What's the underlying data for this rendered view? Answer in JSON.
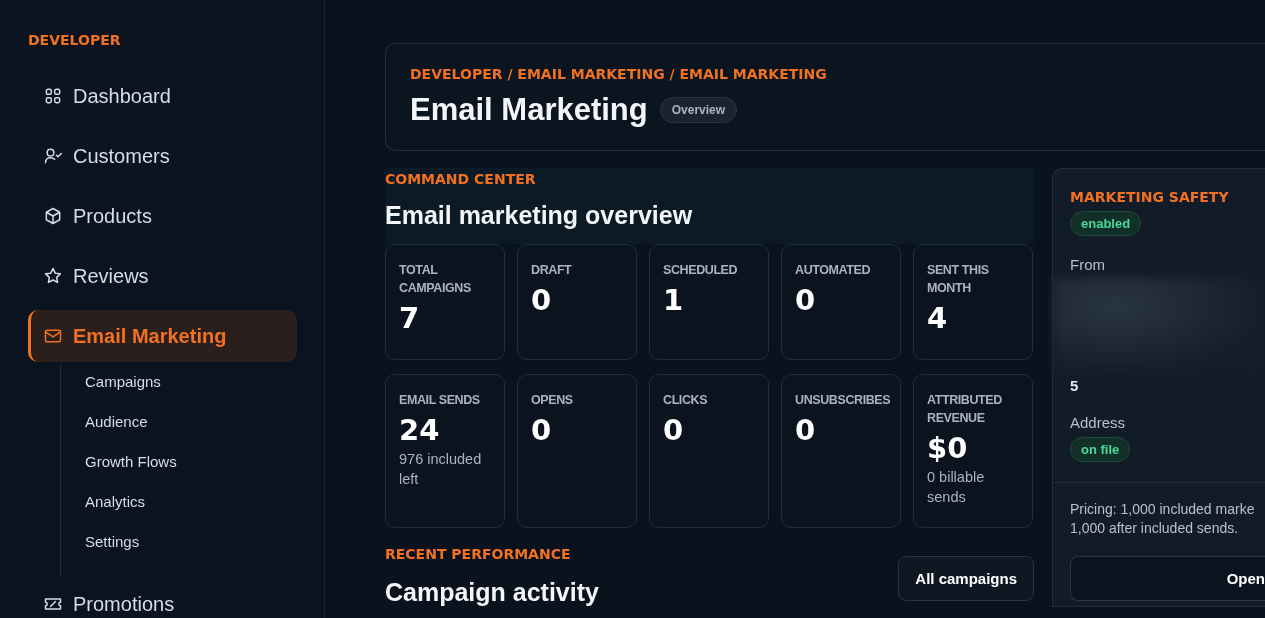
{
  "sidebar": {
    "section_label": "DEVELOPER",
    "items": [
      {
        "label": "Dashboard",
        "selected": false
      },
      {
        "label": "Customers",
        "selected": false
      },
      {
        "label": "Products",
        "selected": false
      },
      {
        "label": "Reviews",
        "selected": false
      },
      {
        "label": "Email Marketing",
        "selected": true,
        "children": [
          {
            "label": "Campaigns"
          },
          {
            "label": "Audience"
          },
          {
            "label": "Growth Flows"
          },
          {
            "label": "Analytics"
          },
          {
            "label": "Settings"
          }
        ]
      },
      {
        "label": "Promotions",
        "selected": false
      }
    ]
  },
  "header": {
    "breadcrumb": "DEVELOPER / EMAIL MARKETING / EMAIL MARKETING",
    "title": "Email Marketing",
    "badge": "Overview"
  },
  "command_center": {
    "eyebrow": "COMMAND CENTER",
    "title": "Email marketing overview",
    "stats": [
      {
        "label": "TOTAL CAMPAIGNS",
        "value": "7"
      },
      {
        "label": "DRAFT",
        "value": "0"
      },
      {
        "label": "SCHEDULED",
        "value": "1"
      },
      {
        "label": "AUTOMATED",
        "value": "0"
      },
      {
        "label": "SENT THIS MONTH",
        "value": "4"
      },
      {
        "label": "EMAIL SENDS",
        "value": "24",
        "note": "976 included left"
      },
      {
        "label": "OPENS",
        "value": "0"
      },
      {
        "label": "CLICKS",
        "value": "0"
      },
      {
        "label": "UNSUBSCRIBES",
        "value": "0"
      },
      {
        "label": "ATTRIBUTED REVENUE",
        "value": "$0",
        "note": "0 billable sends"
      }
    ]
  },
  "recent_performance": {
    "eyebrow": "RECENT PERFORMANCE",
    "title": "Campaign activity",
    "button": "All campaigns"
  },
  "safety_panel": {
    "title": "MARKETING SAFETY",
    "status": "enabled",
    "from_label": "From",
    "from_value": "5",
    "address_label": "Address",
    "address_status": "on file",
    "pricing": "Pricing: 1,000 included marke\n1,000 after included sends.",
    "button": "Open"
  }
}
